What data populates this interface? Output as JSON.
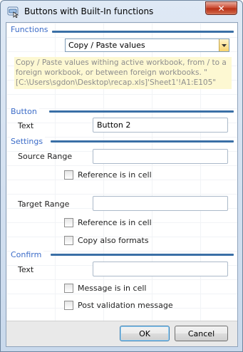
{
  "window": {
    "title": "Buttons with Built-In functions",
    "close_label": "✕"
  },
  "functions": {
    "section_label": "Functions",
    "selected": "Copy / Paste values",
    "description": "Copy / Paste values withing active workbook, from / to a foreign workbook, or between foreign workbooks. \"[C:\\Users\\sgdon\\Desktop\\recap.xls]'Sheet1'!A1:E105\""
  },
  "button": {
    "section_label": "Button",
    "text_label": "Text",
    "text_value": "Button 2"
  },
  "settings": {
    "section_label": "Settings",
    "source_range_label": "Source Range",
    "source_range_value": "",
    "source_ref_in_cell_label": "Reference is in cell",
    "target_range_label": "Target Range",
    "target_range_value": "",
    "target_ref_in_cell_label": "Reference is in cell",
    "copy_formats_label": "Copy also formats"
  },
  "confirm": {
    "section_label": "Confirm",
    "text_label": "Text",
    "text_value": "",
    "message_in_cell_label": "Message is in cell",
    "post_validation_label": "Post validation message"
  },
  "footer": {
    "ok_label": "OK",
    "cancel_label": "Cancel"
  },
  "colors": {
    "section_text": "#3c6cc8",
    "section_line": "#3a6fa6",
    "description_bg": "#fdf8d2",
    "close_button": "#c8452c"
  }
}
